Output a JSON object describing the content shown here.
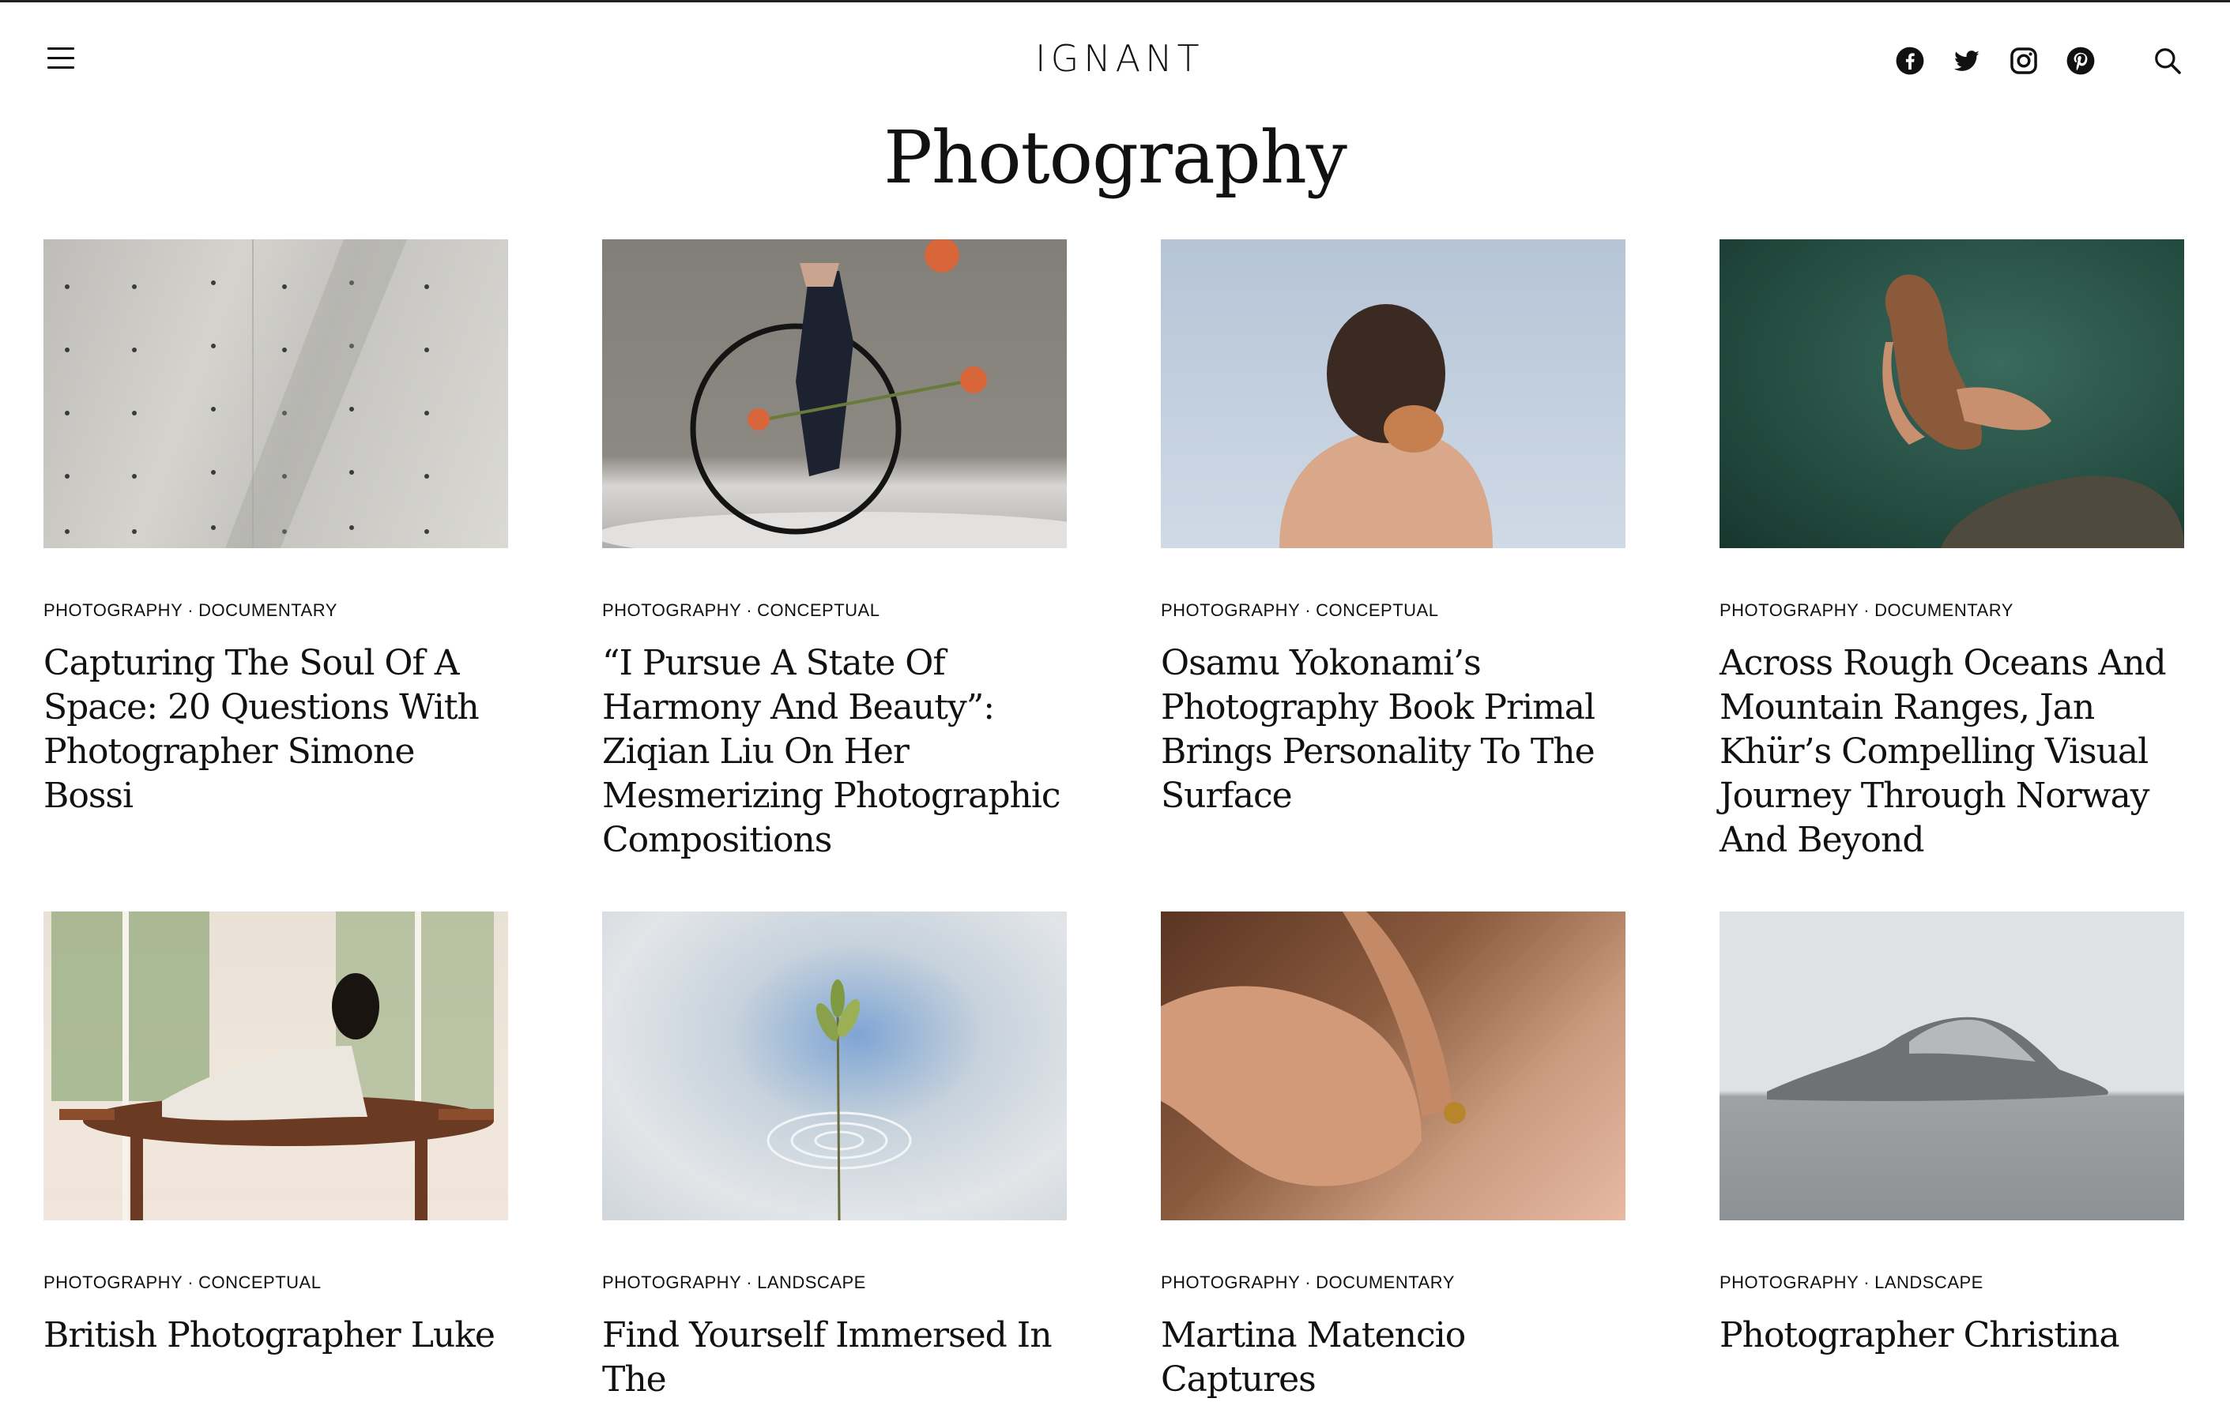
{
  "site": {
    "logo_text": "IGNANT"
  },
  "header": {
    "social_icons": [
      "facebook-icon",
      "twitter-icon",
      "instagram-icon",
      "pinterest-icon"
    ],
    "search_icon": "search-icon",
    "menu_icon": "hamburger-menu-icon"
  },
  "page": {
    "title": "Photography"
  },
  "articles": [
    {
      "category": "PHOTOGRAPHY",
      "subcategory": "DOCUMENTARY",
      "title": "Capturing The Soul Of A Space: 20 Questions With Photographer Simone Bossi"
    },
    {
      "category": "PHOTOGRAPHY",
      "subcategory": "CONCEPTUAL",
      "title": "“I Pursue A State Of Harmony And Beauty”: Ziqian Liu On Her Mesmerizing Photographic Compositions"
    },
    {
      "category": "PHOTOGRAPHY",
      "subcategory": "CONCEPTUAL",
      "title": "Osamu Yokonami’s Photography Book Primal Brings Personality To The Surface"
    },
    {
      "category": "PHOTOGRAPHY",
      "subcategory": "DOCUMENTARY",
      "title": "Across Rough Oceans And Mountain Ranges, Jan Khür’s Compelling Visual Journey Through Norway And Beyond"
    },
    {
      "category": "PHOTOGRAPHY",
      "subcategory": "CONCEPTUAL",
      "title": "British Photographer Luke"
    },
    {
      "category": "PHOTOGRAPHY",
      "subcategory": "LANDSCAPE",
      "title": "Find Yourself Immersed In The"
    },
    {
      "category": "PHOTOGRAPHY",
      "subcategory": "DOCUMENTARY",
      "title": "Martina Matencio Captures"
    },
    {
      "category": "PHOTOGRAPHY",
      "subcategory": "LANDSCAPE",
      "title": "Photographer Christina"
    }
  ],
  "separator": "·",
  "colors": {
    "text": "#111111",
    "background": "#ffffff"
  }
}
